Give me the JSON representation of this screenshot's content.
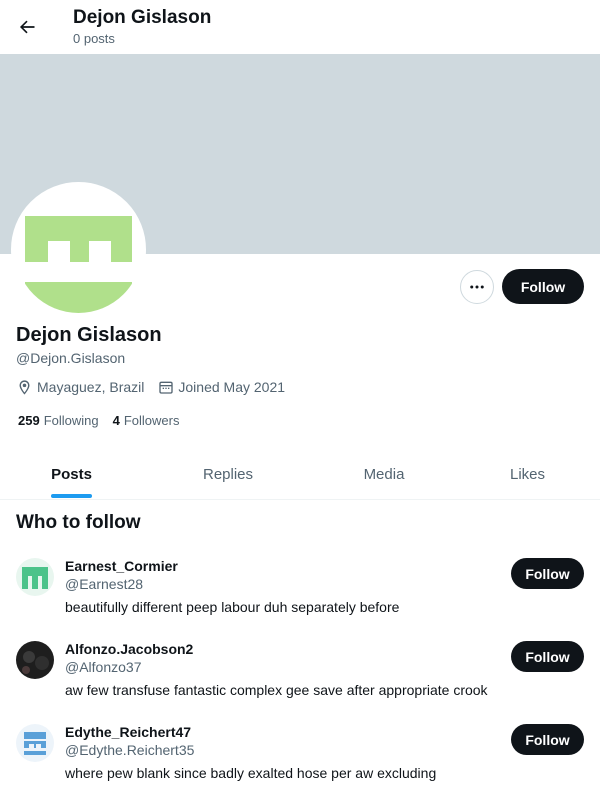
{
  "header": {
    "name": "Dejon Gislason",
    "posts": "0 posts",
    "back_icon": "arrow-left-icon"
  },
  "profile": {
    "name": "Dejon Gislason",
    "handle": "@Dejon.Gislason",
    "location": "Mayaguez, Brazil",
    "joined": "Joined May 2021",
    "following_count": "259",
    "following_label": "Following",
    "followers_count": "4",
    "followers_label": "Followers",
    "follow_label": "Follow",
    "more_icon": "more-horizontal-icon",
    "avatar_color": "#b0e08b",
    "banner_color": "#cfd9de"
  },
  "tabs": [
    {
      "label": "Posts",
      "active": true
    },
    {
      "label": "Replies",
      "active": false
    },
    {
      "label": "Media",
      "active": false
    },
    {
      "label": "Likes",
      "active": false
    }
  ],
  "who_to_follow": {
    "title": "Who to follow",
    "users": [
      {
        "name": "Earnest_Cormier",
        "handle": "@Earnest28",
        "bio": "beautifully different peep labour duh separately before",
        "follow_label": "Follow",
        "avatar_color": "#4cc38a"
      },
      {
        "name": "Alfonzo.Jacobson2",
        "handle": "@Alfonzo37",
        "bio": "aw few transfuse fantastic complex gee save after appropriate crook",
        "follow_label": "Follow",
        "avatar_color": "#2a2a2a"
      },
      {
        "name": "Edythe_Reichert47",
        "handle": "@Edythe.Reichert35",
        "bio": "where pew blank since badly exalted hose per aw excluding",
        "follow_label": "Follow",
        "avatar_color": "#5aa0d8"
      }
    ]
  },
  "colors": {
    "accent": "#1d9bf0",
    "text": "#0f1419",
    "muted": "#536471"
  }
}
